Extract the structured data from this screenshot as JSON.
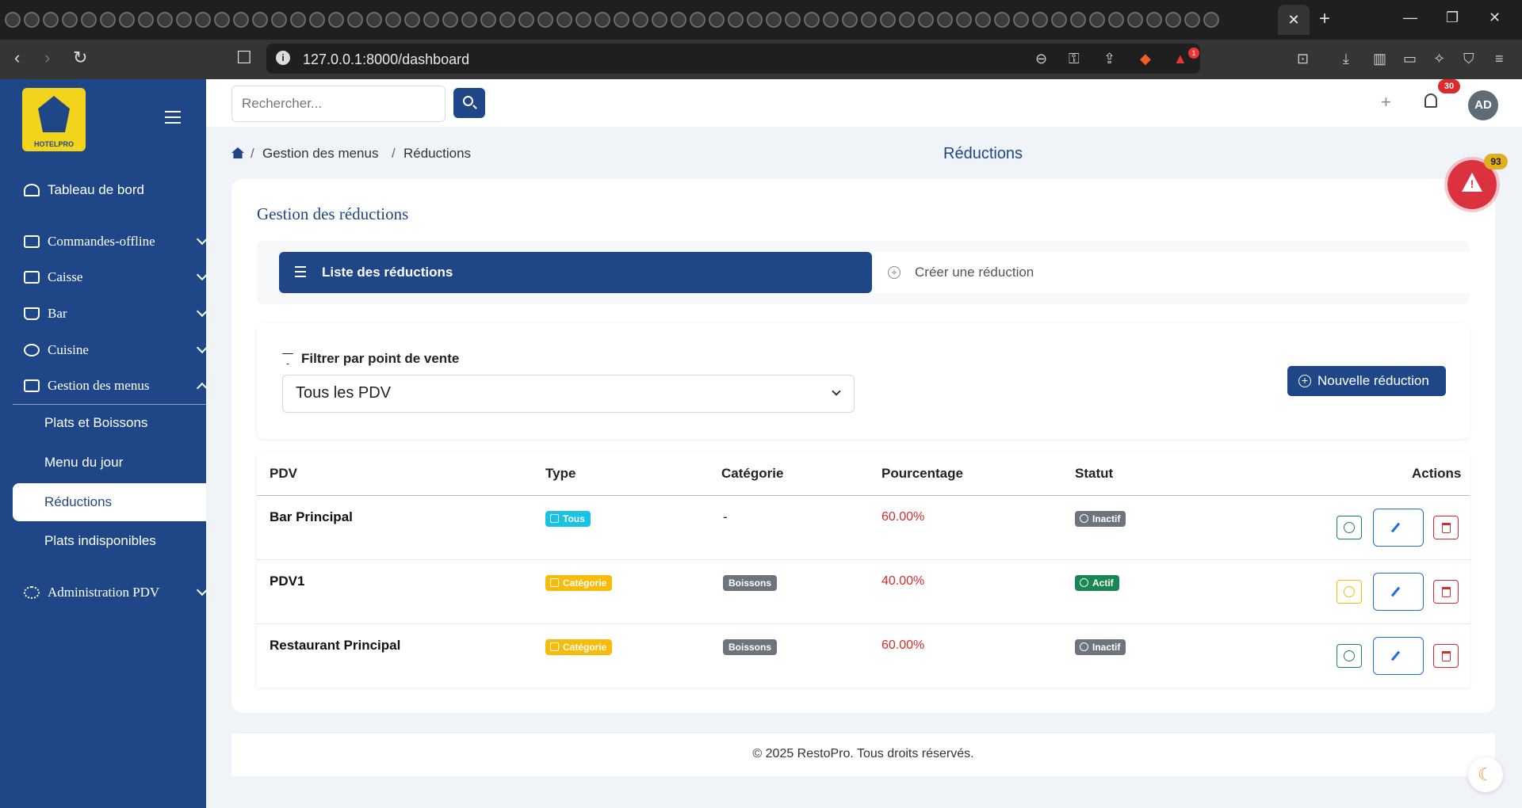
{
  "browser": {
    "url": "127.0.0.1:8000/dashboard",
    "close_tab": "✕",
    "new_tab": "+",
    "alert_count": "1"
  },
  "sidebar": {
    "logo_text": "HOTELPRO",
    "items": [
      {
        "label": "Tableau de bord"
      },
      {
        "label": "Commandes-offline"
      },
      {
        "label": "Caisse"
      },
      {
        "label": "Bar"
      },
      {
        "label": "Cuisine"
      },
      {
        "label": "Gestion des menus"
      },
      {
        "label": "Administration PDV"
      }
    ],
    "sub_items": [
      {
        "label": "Plats et Boissons"
      },
      {
        "label": "Menu du jour"
      },
      {
        "label": "Réductions"
      },
      {
        "label": "Plats indisponibles"
      }
    ]
  },
  "topbar": {
    "search_placeholder": "Rechercher...",
    "notifications_count": "30",
    "avatar_initials": "AD"
  },
  "breadcrumb": {
    "items": [
      "Gestion des menus",
      "Réductions"
    ]
  },
  "page": {
    "title": "Réductions",
    "card_title": "Gestion des réductions"
  },
  "tabs": {
    "list": "Liste des réductions",
    "create": "Créer une réduction"
  },
  "filter": {
    "label": "Filtrer par point de vente",
    "selected": "Tous les PDV",
    "new_button": "Nouvelle réduction"
  },
  "table": {
    "headers": [
      "PDV",
      "Type",
      "Catégorie",
      "Pourcentage",
      "Statut",
      "Actions"
    ],
    "rows": [
      {
        "pdv": "Bar Principal",
        "type": "Tous",
        "categorie": "-",
        "pourcentage": "60.00%",
        "statut": "Inactif"
      },
      {
        "pdv": "PDV1",
        "type": "Catégorie",
        "categorie": "Boissons",
        "pourcentage": "40.00%",
        "statut": "Actif"
      },
      {
        "pdv": "Restaurant Principal",
        "type": "Catégorie",
        "categorie": "Boissons",
        "pourcentage": "60.00%",
        "statut": "Inactif"
      }
    ]
  },
  "footer": {
    "text": "© 2025 RestoPro. Tous droits réservés."
  },
  "floating": {
    "alert_count": "93"
  },
  "colors": {
    "primary": "#1f4788",
    "danger": "#d62b2b",
    "success": "#198754",
    "warning": "#f7bb0b",
    "info": "#18c3e6"
  }
}
